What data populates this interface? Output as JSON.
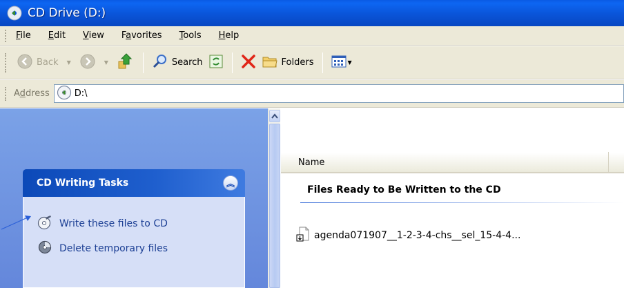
{
  "window": {
    "title": "CD Drive (D:)"
  },
  "menu": [
    {
      "pre": "",
      "u": "F",
      "post": "ile"
    },
    {
      "pre": "",
      "u": "E",
      "post": "dit"
    },
    {
      "pre": "",
      "u": "V",
      "post": "iew"
    },
    {
      "pre": "F",
      "u": "a",
      "post": "vorites"
    },
    {
      "pre": "",
      "u": "T",
      "post": "ools"
    },
    {
      "pre": "",
      "u": "H",
      "post": "elp"
    }
  ],
  "toolbar": {
    "back_label": "Back",
    "search_label": "Search",
    "folders_label": "Folders"
  },
  "address": {
    "label_pre": "A",
    "label_u": "d",
    "label_post": "dress",
    "value": "D:\\"
  },
  "tasks": {
    "title": "CD Writing Tasks",
    "items": [
      {
        "label": "Write these files to CD"
      },
      {
        "label": "Delete temporary files"
      }
    ]
  },
  "files": {
    "column_name": "Name",
    "group_title": "Files Ready to Be Written to the CD",
    "items": [
      {
        "name": "agenda071907__1-2-3-4-chs__sel_15-4-4..."
      }
    ]
  },
  "colors": {
    "titlebar": "#0a54d8",
    "chrome": "#ece9d8",
    "taskpane": "#7ba2e7",
    "task_header": "#0c49b8",
    "task_link": "#1c3f94"
  }
}
